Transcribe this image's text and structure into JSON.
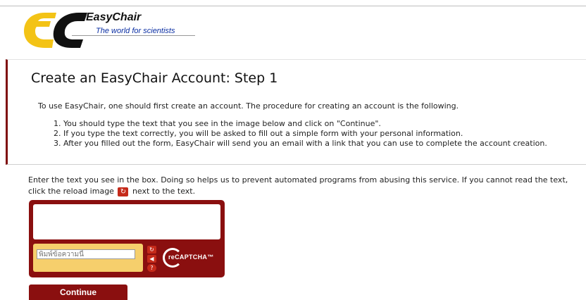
{
  "header": {
    "logo_word": "EasyChair",
    "logo_tagline": "The world for scientists"
  },
  "step": {
    "title": "Create an EasyChair Account: Step 1",
    "intro": "To use EasyChair, one should first create an account. The procedure for creating an account is the following.",
    "items": [
      "1. You should type the text that you see in the image below and click on \"Continue\".",
      "2. If you type the text correctly, you will be asked to fill out a simple form with your personal information.",
      "3. After you filled out the form, EasyChair will send you an email with a link that you can use to complete the account creation."
    ]
  },
  "captcha": {
    "instruction_before": "Enter the text you see in the box. Doing so helps us to prevent automated programs from abusing this service. If you cannot read the text, click the reload image",
    "instruction_after": "next to the text.",
    "placeholder": "พิมพ์ข้อความนี้",
    "logo_text": "reCAPTCHA™",
    "icons": [
      "reload-icon",
      "audio-icon",
      "help-icon"
    ],
    "colors": {
      "frame": "#8a0f0f",
      "response_area": "#f6cf6c",
      "accent": "#c52a1a"
    }
  },
  "actions": {
    "continue_label": "Continue"
  }
}
